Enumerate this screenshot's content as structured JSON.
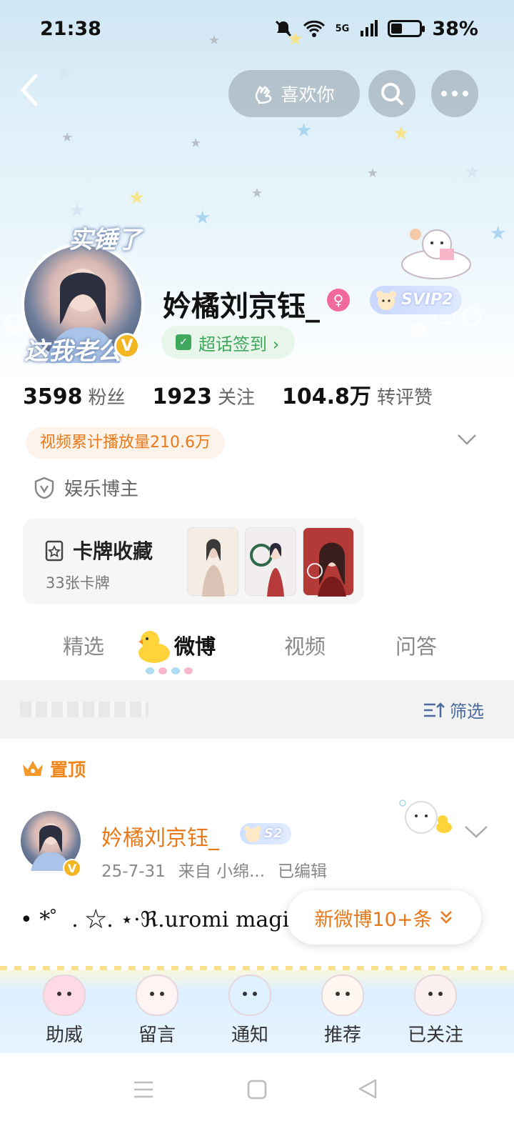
{
  "status_bar": {
    "time": "21:38",
    "network": "5G",
    "battery_percent": 38,
    "battery_label": "38%",
    "icons": [
      "mute-bell-icon",
      "wifi-icon",
      "cell-signal-icon",
      "battery-icon"
    ]
  },
  "top_bar": {
    "back_icon": "chevron-left-icon",
    "like_label": "喜欢你",
    "like_icon": "hand-heart-icon",
    "search_icon": "search-icon",
    "more_icon": "more-dots-icon"
  },
  "profile": {
    "avatar_frame_top": "实锤了",
    "avatar_frame_bottom": "这我老公",
    "verified_badge": "V",
    "username": "妗橘刘京钰_",
    "gender_icon": "female-icon",
    "vip_label": "SVIP2",
    "checkin_label": "超话签到 ›",
    "stats": [
      {
        "num": "3598",
        "label": "粉丝"
      },
      {
        "num": "1923",
        "label": "关注"
      },
      {
        "num": "104.8万",
        "label": "转评赞"
      }
    ],
    "video_plays": "视频累计播放量210.6万",
    "role": "娱乐博主",
    "cards": {
      "title": "卡牌收藏",
      "count": "33张卡牌",
      "thumb_colors": [
        "#f5ece4",
        "#f2eef0",
        "#b33a36"
      ]
    }
  },
  "tabs": [
    {
      "label": "精选",
      "active": false
    },
    {
      "label": "微博",
      "active": true
    },
    {
      "label": "视频",
      "active": false
    },
    {
      "label": "问答",
      "active": false
    }
  ],
  "filter": {
    "label": "筛选",
    "icon": "sort-icon"
  },
  "pinned": {
    "label": "置顶",
    "icon": "crown-icon"
  },
  "post": {
    "author": "妗橘刘京钰_",
    "level_badge": "S2",
    "date": "25-7-31",
    "source": "来自 小绵...",
    "edited": "已编辑",
    "text": "• *゜. ☆. ⋆·ℜ.uromi magic",
    "new_posts": "新微博10+条"
  },
  "bottom_nav": [
    {
      "label": "助威",
      "face": "#ffd9e6"
    },
    {
      "label": "留言",
      "face": "#fff3f3"
    },
    {
      "label": "通知",
      "face": "#dff1ff"
    },
    {
      "label": "推荐",
      "face": "#fff7f0"
    },
    {
      "label": "已关注",
      "face": "#fdf0f0"
    }
  ],
  "colors": {
    "accent_orange": "#e8791a",
    "checkin_green": "#40a85c",
    "verified_gold": "#f3b623",
    "gender_pink": "#f26a9b",
    "filter_blue": "#4a6aa0"
  }
}
